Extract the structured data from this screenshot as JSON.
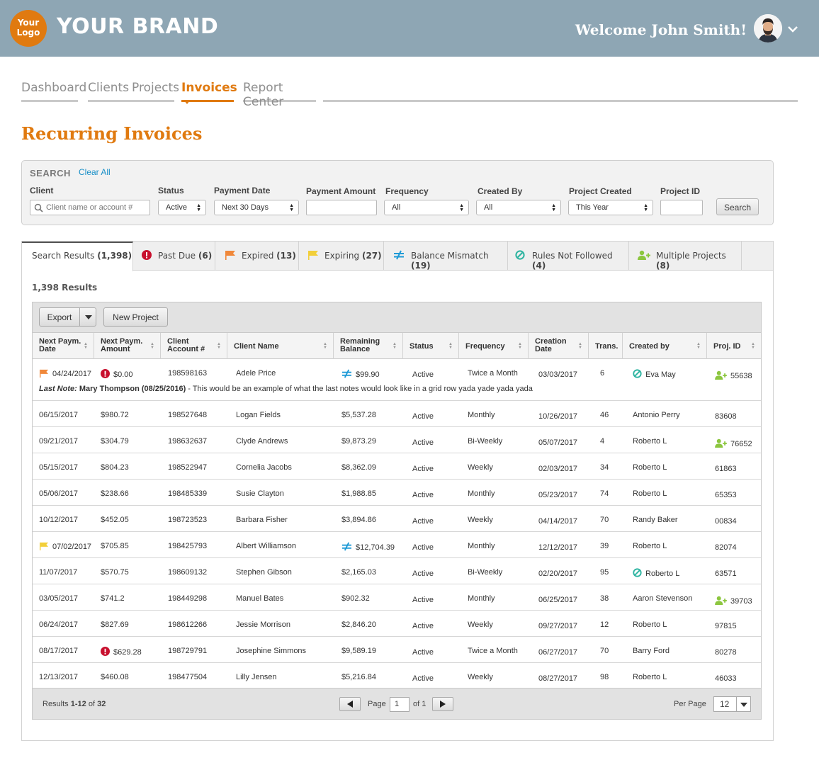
{
  "header": {
    "logo_line1": "Your",
    "logo_line2": "Logo",
    "brand": "YOUR BRAND",
    "welcome": "Welcome John Smith!"
  },
  "nav": {
    "items": [
      {
        "label": "Dashboard"
      },
      {
        "label": "Clients"
      },
      {
        "label": "Projects"
      },
      {
        "label": "Invoices"
      },
      {
        "label": "Report Center"
      }
    ],
    "active": "Invoices"
  },
  "page_title": "Recurring Invoices",
  "search": {
    "title": "SEARCH",
    "clear_all": "Clear All",
    "client_label": "Client",
    "client_placeholder": "Client name or account #",
    "status_label": "Status",
    "status_value": "Active",
    "payment_date_label": "Payment Date",
    "payment_date_value": "Next 30 Days",
    "payment_amount_label": "Payment Amount",
    "payment_amount_value": "",
    "frequency_label": "Frequency",
    "frequency_value": "All",
    "created_by_label": "Created By",
    "created_by_value": "All",
    "project_created_label": "Project Created",
    "project_created_value": "This Year",
    "project_id_label": "Project ID",
    "project_id_value": "",
    "search_button": "Search"
  },
  "tabs": [
    {
      "label": "Search Results",
      "count": "(1,398)",
      "icon": "none"
    },
    {
      "label": "Past Due",
      "count": "(6)",
      "icon": "alert-icon"
    },
    {
      "label": "Expired",
      "count": "(13)",
      "icon": "flag-orange-icon"
    },
    {
      "label": "Expiring",
      "count": "(27)",
      "icon": "flag-yellow-icon"
    },
    {
      "label": "Balance Mismatch",
      "count": "(19)",
      "icon": "not-equal-icon"
    },
    {
      "label": "Rules Not Followed",
      "count": "(4)",
      "icon": "prohibited-icon"
    },
    {
      "label": "Multiple Projects",
      "count": "(8)",
      "icon": "add-user-icon"
    }
  ],
  "results_count": "1,398 Results",
  "toolbar": {
    "export_label": "Export",
    "new_project_label": "New Project"
  },
  "columns": {
    "next_date_l1": "Next Paym.",
    "next_date_l2": "Date",
    "next_amount_l1": "Next Paym.",
    "next_amount_l2": "Amount",
    "account_l1": "Client",
    "account_l2": "Account #",
    "client_name": "Client Name",
    "balance_l1": "Remaining",
    "balance_l2": "Balance",
    "status": "Status",
    "frequency": "Frequency",
    "creation_l1": "Creation",
    "creation_l2": "Date",
    "trans": "Trans.",
    "created_by": "Created by",
    "proj_id": "Proj. ID"
  },
  "rows": [
    {
      "date": "04/24/2017",
      "amount": "$0.00",
      "account": "198598163",
      "name": "Adele Price",
      "balance": "$99.90",
      "status": "Active",
      "frequency": "Twice a Month",
      "creation": "03/03/2017",
      "trans": "6",
      "created_by": "Eva May",
      "proj_id": "55638",
      "flag": "orange",
      "alert": true,
      "mismatch": true,
      "rule": true,
      "multi": true,
      "note_label": "Last Note:",
      "note_author": "Mary Thompson (08/25/2016)",
      "note_text": " - This would be an example of what the last notes would look like in a grid row yada yade yada yada"
    },
    {
      "date": "06/15/2017",
      "amount": "$980.72",
      "account": "198527648",
      "name": "Logan Fields",
      "balance": "$5,537.28",
      "status": "Active",
      "frequency": "Monthly",
      "creation": "10/26/2017",
      "trans": "46",
      "created_by": "Antonio Perry",
      "proj_id": "83608"
    },
    {
      "date": "09/21/2017",
      "amount": "$304.79",
      "account": "198632637",
      "name": "Clyde Andrews",
      "balance": "$9,873.29",
      "status": "Active",
      "frequency": "Bi-Weekly",
      "creation": "05/07/2017",
      "trans": "4",
      "created_by": "Roberto L",
      "proj_id": "76652",
      "multi": true
    },
    {
      "date": "05/15/2017",
      "amount": "$804.23",
      "account": "198522947",
      "name": "Cornelia Jacobs",
      "balance": "$8,362.09",
      "status": "Active",
      "frequency": "Weekly",
      "creation": "02/03/2017",
      "trans": "34",
      "created_by": "Roberto L",
      "proj_id": "61863"
    },
    {
      "date": "05/06/2017",
      "amount": "$238.66",
      "account": "198485339",
      "name": "Susie Clayton",
      "balance": "$1,988.85",
      "status": "Active",
      "frequency": "Monthly",
      "creation": "05/23/2017",
      "trans": "74",
      "created_by": "Roberto L",
      "proj_id": "65353"
    },
    {
      "date": "10/12/2017",
      "amount": "$452.05",
      "account": "198723523",
      "name": "Barbara Fisher",
      "balance": "$3,894.86",
      "status": "Active",
      "frequency": "Weekly",
      "creation": "04/14/2017",
      "trans": "70",
      "created_by": "Randy Baker",
      "proj_id": "00834"
    },
    {
      "date": "07/02/2017",
      "amount": "$705.85",
      "account": "198425793",
      "name": "Albert Williamson",
      "balance": "$12,704.39",
      "status": "Active",
      "frequency": "Monthly",
      "creation": "12/12/2017",
      "trans": "39",
      "created_by": "Roberto L",
      "proj_id": "82074",
      "flag": "yellow",
      "mismatch": true
    },
    {
      "date": "11/07/2017",
      "amount": "$570.75",
      "account": "198609132",
      "name": "Stephen Gibson",
      "balance": "$2,165.03",
      "status": "Active",
      "frequency": "Bi-Weekly",
      "creation": "02/20/2017",
      "trans": "95",
      "created_by": "Roberto L",
      "proj_id": "63571",
      "rule": true
    },
    {
      "date": "03/05/2017",
      "amount": "$741.2",
      "account": "198449298",
      "name": "Manuel Bates",
      "balance": "$902.32",
      "status": "Active",
      "frequency": "Monthly",
      "creation": "06/25/2017",
      "trans": "38",
      "created_by": "Aaron Stevenson",
      "proj_id": "39703",
      "multi": true
    },
    {
      "date": "06/24/2017",
      "amount": "$827.69",
      "account": "198612266",
      "name": "Jessie Morrison",
      "balance": "$2,846.20",
      "status": "Active",
      "frequency": "Weekly",
      "creation": "09/27/2017",
      "trans": "12",
      "created_by": "Roberto L",
      "proj_id": "97815"
    },
    {
      "date": "08/17/2017",
      "amount": "$629.28",
      "account": "198729791",
      "name": "Josephine Simmons",
      "balance": "$9,589.19",
      "status": "Active",
      "frequency": "Twice a Month",
      "creation": "06/27/2017",
      "trans": "70",
      "created_by": "Barry Ford",
      "proj_id": "80278",
      "alert": true
    },
    {
      "date": "12/13/2017",
      "amount": "$460.08",
      "account": "198477504",
      "name": "Lilly Jensen",
      "balance": "$5,216.84",
      "status": "Active",
      "frequency": "Weekly",
      "creation": "08/27/2017",
      "trans": "98",
      "created_by": "Roberto L",
      "proj_id": "46033"
    }
  ],
  "footer": {
    "results_prefix": "Results ",
    "results_range": "1-12",
    "results_of": " of ",
    "results_total": "32",
    "page_label": "Page",
    "page_value": "1",
    "of_pages": "of 1",
    "per_page_label": "Per Page",
    "per_page_value": "12"
  },
  "colors": {
    "brand_orange": "#e07a10",
    "header_bg": "#8ea6b4",
    "alert_red": "#c8102e",
    "flag_orange": "#f0883a",
    "flag_yellow": "#f2cf3a",
    "mismatch_blue": "#1e9ad6",
    "rule_teal": "#2bb3a0",
    "multi_green": "#8cc63f"
  }
}
